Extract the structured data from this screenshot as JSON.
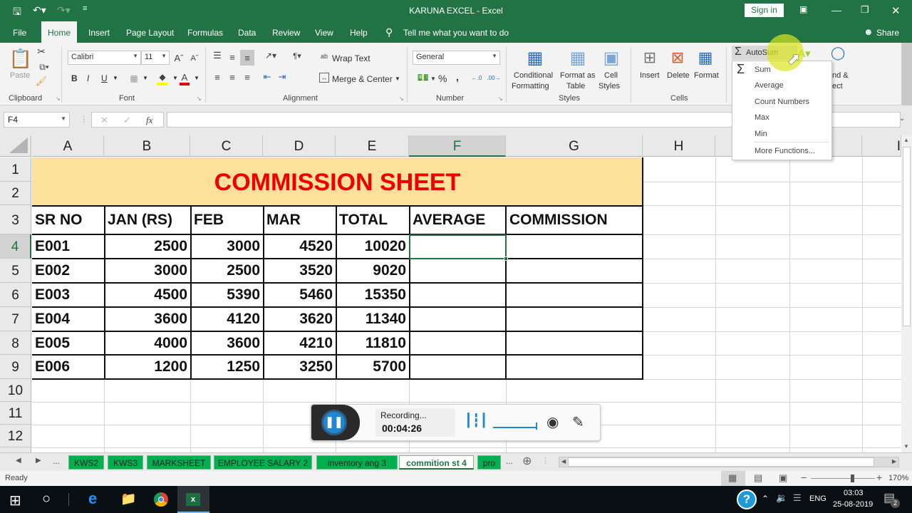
{
  "window": {
    "title": "KARUNA EXCEL  -  Excel",
    "sign_in": "Sign in",
    "share": "Share"
  },
  "quick_access": [
    "save-icon",
    "undo-icon",
    "redo-icon",
    "customize-icon"
  ],
  "menu": {
    "items": [
      "File",
      "Home",
      "Insert",
      "Page Layout",
      "Formulas",
      "Data",
      "Review",
      "View",
      "Help"
    ],
    "active": "Home",
    "tell_me": "Tell me what you want to do"
  },
  "ribbon": {
    "clipboard": {
      "label": "Clipboard",
      "paste": "Paste"
    },
    "font": {
      "label": "Font",
      "name": "Calibri",
      "size": "11",
      "bold": "B",
      "italic": "I",
      "underline": "U"
    },
    "alignment": {
      "label": "Alignment",
      "wrap_text": "Wrap Text",
      "merge_center": "Merge & Center"
    },
    "number": {
      "label": "Number",
      "format": "General",
      "percent": "%",
      "comma": ","
    },
    "styles": {
      "label": "Styles",
      "conditional_1": "Conditional",
      "conditional_2": "Formatting",
      "format_table_1": "Format as",
      "format_table_2": "Table",
      "cell_styles_1": "Cell",
      "cell_styles_2": "Styles"
    },
    "cells": {
      "label": "Cells",
      "insert": "Insert",
      "delete": "Delete",
      "format": "Format"
    },
    "editing": {
      "autosum": "AutoSum",
      "find_1": "nd &",
      "find_2": "ect"
    }
  },
  "autosum_menu": {
    "items": [
      "Sum",
      "Average",
      "Count Numbers",
      "Max",
      "Min",
      "More Functions..."
    ]
  },
  "formula_bar": {
    "name_box": "F4",
    "formula": "",
    "cancel": "✕",
    "enter": "✓",
    "fx": "fx"
  },
  "grid": {
    "columns": [
      "A",
      "B",
      "C",
      "D",
      "E",
      "F",
      "G",
      "H",
      "",
      "",
      "I"
    ],
    "rows": [
      "1",
      "2",
      "3",
      "4",
      "5",
      "6",
      "7",
      "8",
      "9",
      "10",
      "11",
      "12"
    ],
    "selected_cell": "F4",
    "title": "COMMISSION SHEET",
    "headers": [
      "SR NO",
      "JAN (RS)",
      "FEB",
      "MAR",
      "TOTAL",
      "AVERAGE",
      "COMMISSION"
    ],
    "data": [
      [
        "E001",
        "2500",
        "3000",
        "4520",
        "10020",
        "",
        ""
      ],
      [
        "E002",
        "3000",
        "2500",
        "3520",
        "9020",
        "",
        ""
      ],
      [
        "E003",
        "4500",
        "5390",
        "5460",
        "15350",
        "",
        ""
      ],
      [
        "E004",
        "3600",
        "4120",
        "3620",
        "11340",
        "",
        ""
      ],
      [
        "E005",
        "4000",
        "3600",
        "4210",
        "11810",
        "",
        ""
      ],
      [
        "E006",
        "1200",
        "1250",
        "3250",
        "5700",
        "",
        ""
      ]
    ]
  },
  "sheet_tabs": {
    "items": [
      "KWS2",
      "KWS3",
      "MARKSHEET",
      "EMPLOYEE SALARY 2",
      "inventory ang 3",
      "commition st 4",
      "pro"
    ],
    "active": "commition st 4",
    "ellipsis": "..."
  },
  "status": {
    "ready": "Ready",
    "zoom": "170%",
    "zoom_fraction": 0.62
  },
  "recorder": {
    "status": "Recording...",
    "time": "00:04:26"
  },
  "taskbar": {
    "time": "03:03",
    "date": "25-08-2019",
    "language": "ENG",
    "notifications": "2"
  },
  "colors": {
    "excel_green": "#217346",
    "title_fill": "#fde19a",
    "title_text": "#ee0000",
    "tab_green": "#00b050"
  }
}
